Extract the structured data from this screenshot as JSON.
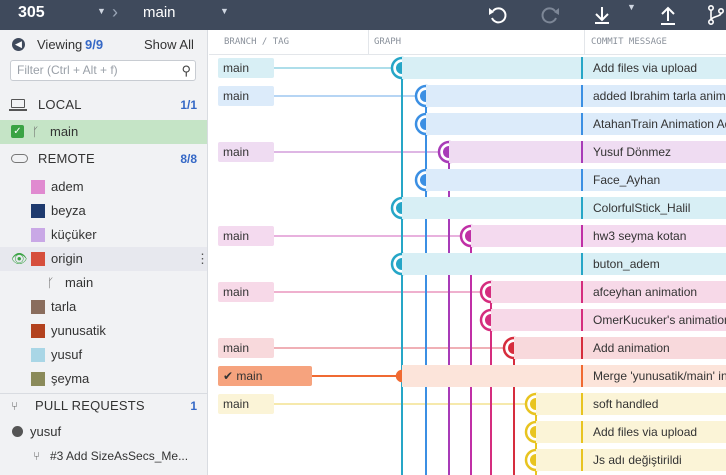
{
  "toolbar": {
    "repo": "305",
    "branch": "main",
    "icons": [
      "undo-icon",
      "redo-icon",
      "pull-icon",
      "pull-dropdown-icon",
      "push-icon",
      "branch-icon"
    ]
  },
  "sidebar": {
    "viewing_label": "Viewing",
    "viewing_count": "9/9",
    "show_all": "Show All",
    "filter_placeholder": "Filter (Ctrl + Alt + f)",
    "local": {
      "label": "LOCAL",
      "count": "1/1",
      "branches": [
        {
          "name": "main",
          "checked": true
        }
      ]
    },
    "remote": {
      "label": "REMOTE",
      "count": "8/8",
      "items": [
        {
          "name": "adem"
        },
        {
          "name": "beyza"
        },
        {
          "name": "küçüker"
        },
        {
          "name": "origin"
        },
        {
          "name": "main"
        },
        {
          "name": "tarla"
        },
        {
          "name": "yunusatik"
        },
        {
          "name": "yusuf"
        },
        {
          "name": "şeyma"
        }
      ]
    },
    "pull_requests": {
      "label": "PULL REQUESTS",
      "count": "1",
      "owner": "yusuf",
      "items": [
        {
          "title": "#3 Add SizeAsSecs_Me..."
        }
      ]
    }
  },
  "graph": {
    "headers": {
      "branch": "BRANCH / TAG",
      "graph": "GRAPH",
      "message": "COMMIT MESSAGE"
    },
    "rows": [
      {
        "label": "main",
        "message": "Add files via upload",
        "color": "#26a6c7"
      },
      {
        "label": "main",
        "message": "added Ibrahim tarla animation",
        "color": "#3b8fe3"
      },
      {
        "label": "",
        "message": "AtahanTrain Animation Add",
        "color": "#3b8fe3"
      },
      {
        "label": "main",
        "message": "Yusuf Dönmez",
        "color": "#a83bb8"
      },
      {
        "label": "",
        "message": "Face_Ayhan",
        "color": "#3b8fe3"
      },
      {
        "label": "",
        "message": "ColorfulStick_Halil",
        "color": "#26a6c7"
      },
      {
        "label": "main",
        "message": "hw3 seyma kotan",
        "color": "#c02fa6"
      },
      {
        "label": "",
        "message": "buton_adem",
        "color": "#26a6c7"
      },
      {
        "label": "main",
        "message": "afceyhan animation",
        "color": "#d52d7e"
      },
      {
        "label": "",
        "message": "OmerKucuker's animation",
        "color": "#d52d7e"
      },
      {
        "label": "main",
        "message": "Add animation",
        "color": "#d62d3d"
      },
      {
        "label": "main",
        "message": "Merge 'yunusatik/main' into main",
        "color": "#f06a32"
      },
      {
        "label": "main",
        "message": "soft handled",
        "color": "#e8c420"
      },
      {
        "label": "",
        "message": "Add files via upload",
        "color": "#e8c420"
      },
      {
        "label": "",
        "message": "Js adı değiştirildi",
        "color": "#e8c420"
      }
    ]
  }
}
